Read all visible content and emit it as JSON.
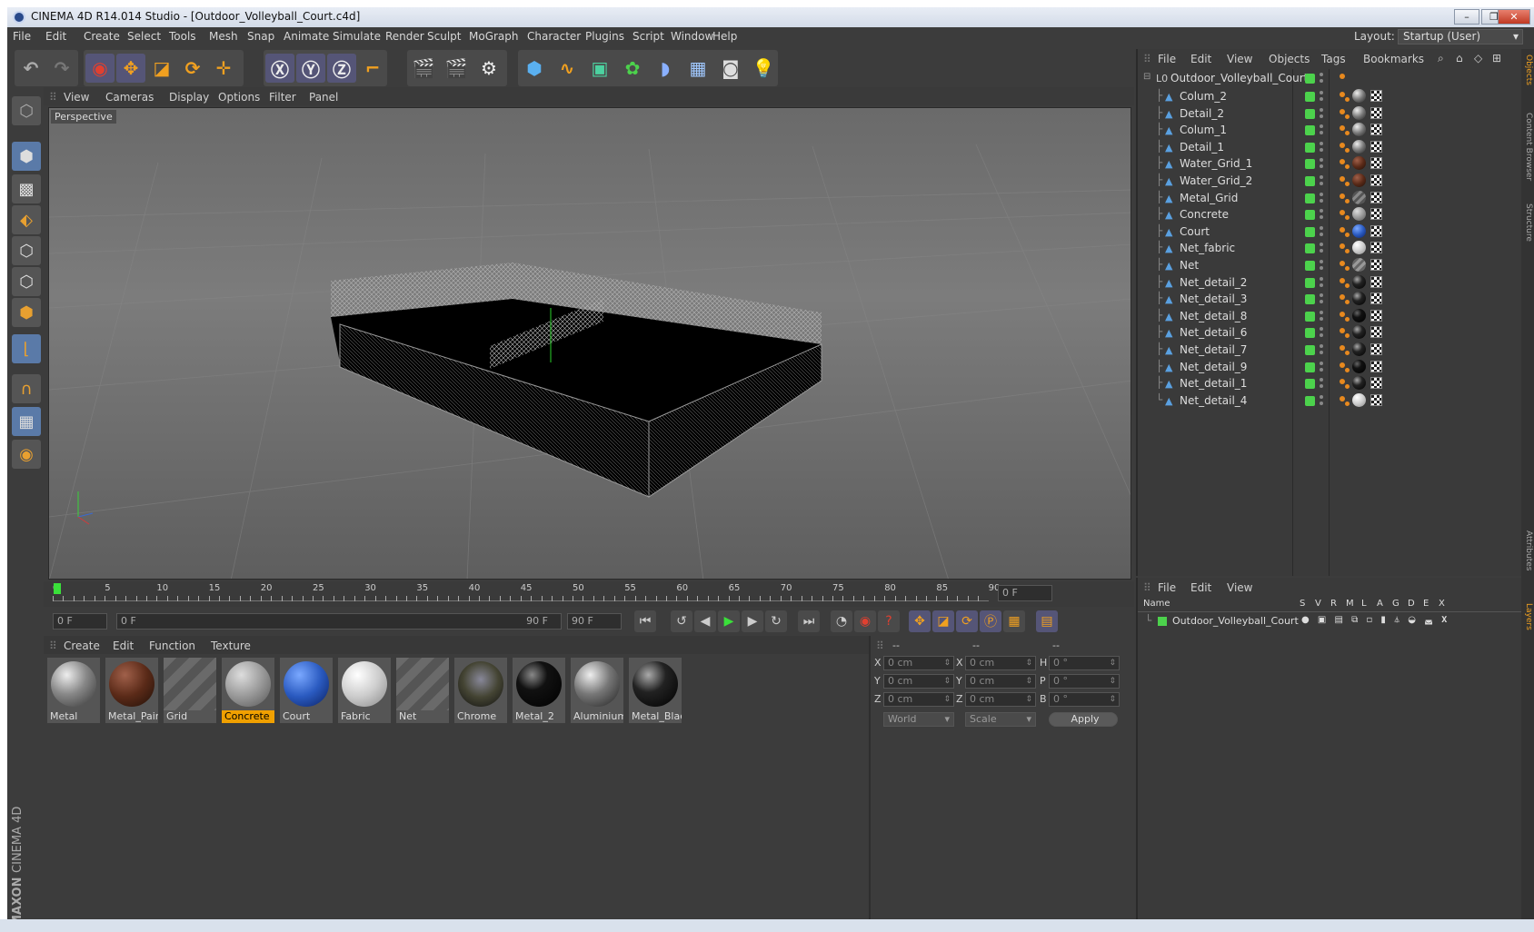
{
  "title": "CINEMA 4D R14.014 Studio - [Outdoor_Volleyball_Court.c4d]",
  "menu": [
    "File",
    "Edit",
    "Create",
    "Select",
    "Tools",
    "Mesh",
    "Snap",
    "Animate",
    "Simulate",
    "Render",
    "Sculpt",
    "MoGraph",
    "Character",
    "Plugins",
    "Script",
    "Window",
    "Help"
  ],
  "layout": {
    "label": "Layout:",
    "value": "Startup (User)"
  },
  "viewport": {
    "menu": [
      "View",
      "Cameras",
      "Display",
      "Options",
      "Filter",
      "Panel"
    ],
    "label": "Perspective"
  },
  "timeline": {
    "ticks": [
      "0",
      "5",
      "10",
      "15",
      "20",
      "25",
      "30",
      "35",
      "40",
      "45",
      "50",
      "55",
      "60",
      "65",
      "70",
      "75",
      "80",
      "85",
      "90"
    ],
    "current": "0 F",
    "start": "0 F",
    "slider_start": "0 F",
    "slider_end": "90 F",
    "end": "90 F"
  },
  "materials": {
    "menu": [
      "Create",
      "Edit",
      "Function",
      "Texture"
    ],
    "items": [
      {
        "name": "Metal",
        "color": "radial-gradient(circle at 35% 30%,#eee,#888 45%,#333)",
        "selected": false
      },
      {
        "name": "Metal_Pain",
        "color": "radial-gradient(circle at 35% 30%,#a0604a,#5a2a18 50%,#201008)",
        "selected": false
      },
      {
        "name": "Grid",
        "color": "",
        "selected": false
      },
      {
        "name": "Concrete",
        "color": "radial-gradient(circle at 35% 30%,#ddd,#999 50%,#555)",
        "selected": true
      },
      {
        "name": "Court",
        "color": "radial-gradient(circle at 35% 30%,#7aa8ff,#2a5ac0 50%,#0a2060)",
        "selected": false
      },
      {
        "name": "Fabric",
        "color": "radial-gradient(circle at 35% 30%,#fff,#ccc 50%,#888)",
        "selected": false
      },
      {
        "name": "Net",
        "color": "",
        "selected": false
      },
      {
        "name": "Chrome",
        "color": "radial-gradient(circle at 50% 40%,#889,#443 50%,#111)",
        "selected": false
      },
      {
        "name": "Metal_2",
        "color": "radial-gradient(circle at 35% 30%,#888,#111 35%,#000)",
        "selected": false
      },
      {
        "name": "Aluminium",
        "color": "radial-gradient(circle at 35% 30%,#eee,#777 45%,#222)",
        "selected": false
      },
      {
        "name": "Metal_Blac",
        "color": "radial-gradient(circle at 35% 30%,#aaa,#222 40%,#000)",
        "selected": false
      }
    ]
  },
  "coords": {
    "headers": [
      "--",
      "--",
      "--"
    ],
    "rows": [
      {
        "a": "X",
        "av": "0 cm",
        "b": "X",
        "bv": "0 cm",
        "c": "H",
        "cv": "0 °"
      },
      {
        "a": "Y",
        "av": "0 cm",
        "b": "Y",
        "bv": "0 cm",
        "c": "P",
        "cv": "0 °"
      },
      {
        "a": "Z",
        "av": "0 cm",
        "b": "Z",
        "bv": "0 cm",
        "c": "B",
        "cv": "0 °"
      }
    ],
    "mode": "World",
    "type": "Scale",
    "apply": "Apply"
  },
  "objects": {
    "menu": [
      "File",
      "Edit",
      "View",
      "Objects",
      "Tags",
      "Bookmarks"
    ],
    "root": "Outdoor_Volleyball_Court",
    "items": [
      {
        "name": "Colum_2",
        "tag": "radial-gradient(circle at 35% 30%,#eee,#777 50%,#222)"
      },
      {
        "name": "Detail_2",
        "tag": "radial-gradient(circle at 35% 30%,#eee,#777 50%,#222)"
      },
      {
        "name": "Colum_1",
        "tag": "radial-gradient(circle at 35% 30%,#eee,#777 50%,#222)"
      },
      {
        "name": "Detail_1",
        "tag": "radial-gradient(circle at 35% 30%,#eee,#777 50%,#222)"
      },
      {
        "name": "Water_Grid_1",
        "tag": "radial-gradient(circle at 35% 30%,#a0604a,#5a2a18 50%,#201008)"
      },
      {
        "name": "Water_Grid_2",
        "tag": "radial-gradient(circle at 35% 30%,#a0604a,#5a2a18 50%,#201008)"
      },
      {
        "name": "Metal_Grid",
        "tag": "repeating-linear-gradient(135deg,#888 0 3px,#555 3px 6px)"
      },
      {
        "name": "Concrete",
        "tag": "radial-gradient(circle at 35% 30%,#ddd,#999 50%,#555)"
      },
      {
        "name": "Court",
        "tag": "radial-gradient(circle at 35% 30%,#7aa8ff,#2a5ac0 50%,#0a2060)"
      },
      {
        "name": "Net_fabric",
        "tag": "radial-gradient(circle at 35% 30%,#fff,#ccc 50%,#888)"
      },
      {
        "name": "Net",
        "tag": "repeating-linear-gradient(135deg,#999 0 3px,#666 3px 6px)"
      },
      {
        "name": "Net_detail_2",
        "tag": "radial-gradient(circle at 35% 30%,#aaa,#222 40%,#000)"
      },
      {
        "name": "Net_detail_3",
        "tag": "radial-gradient(circle at 35% 30%,#aaa,#222 40%,#000)"
      },
      {
        "name": "Net_detail_8",
        "tag": "radial-gradient(circle at 35% 30%,#666,#111 35%,#000)"
      },
      {
        "name": "Net_detail_6",
        "tag": "radial-gradient(circle at 35% 30%,#aaa,#222 40%,#000)"
      },
      {
        "name": "Net_detail_7",
        "tag": "radial-gradient(circle at 35% 30%,#aaa,#222 40%,#000)"
      },
      {
        "name": "Net_detail_9",
        "tag": "radial-gradient(circle at 35% 30%,#666,#111 35%,#000)"
      },
      {
        "name": "Net_detail_1",
        "tag": "radial-gradient(circle at 35% 30%,#aaa,#222 40%,#000)"
      },
      {
        "name": "Net_detail_4",
        "tag": "radial-gradient(circle at 35% 30%,#fff,#ccc 50%,#888)"
      }
    ]
  },
  "layers": {
    "menu": [
      "File",
      "Edit",
      "View"
    ],
    "columns": [
      "Name",
      "S",
      "V",
      "R",
      "M",
      "L",
      "A",
      "G",
      "D",
      "E",
      "X"
    ],
    "row": "Outdoor_Volleyball_Court"
  },
  "sidetabs": [
    "Objects",
    "Content Browser",
    "Structure",
    "Attributes",
    "Layers"
  ],
  "brand": {
    "maxon": "MAXON",
    "product": "CINEMA 4D"
  }
}
